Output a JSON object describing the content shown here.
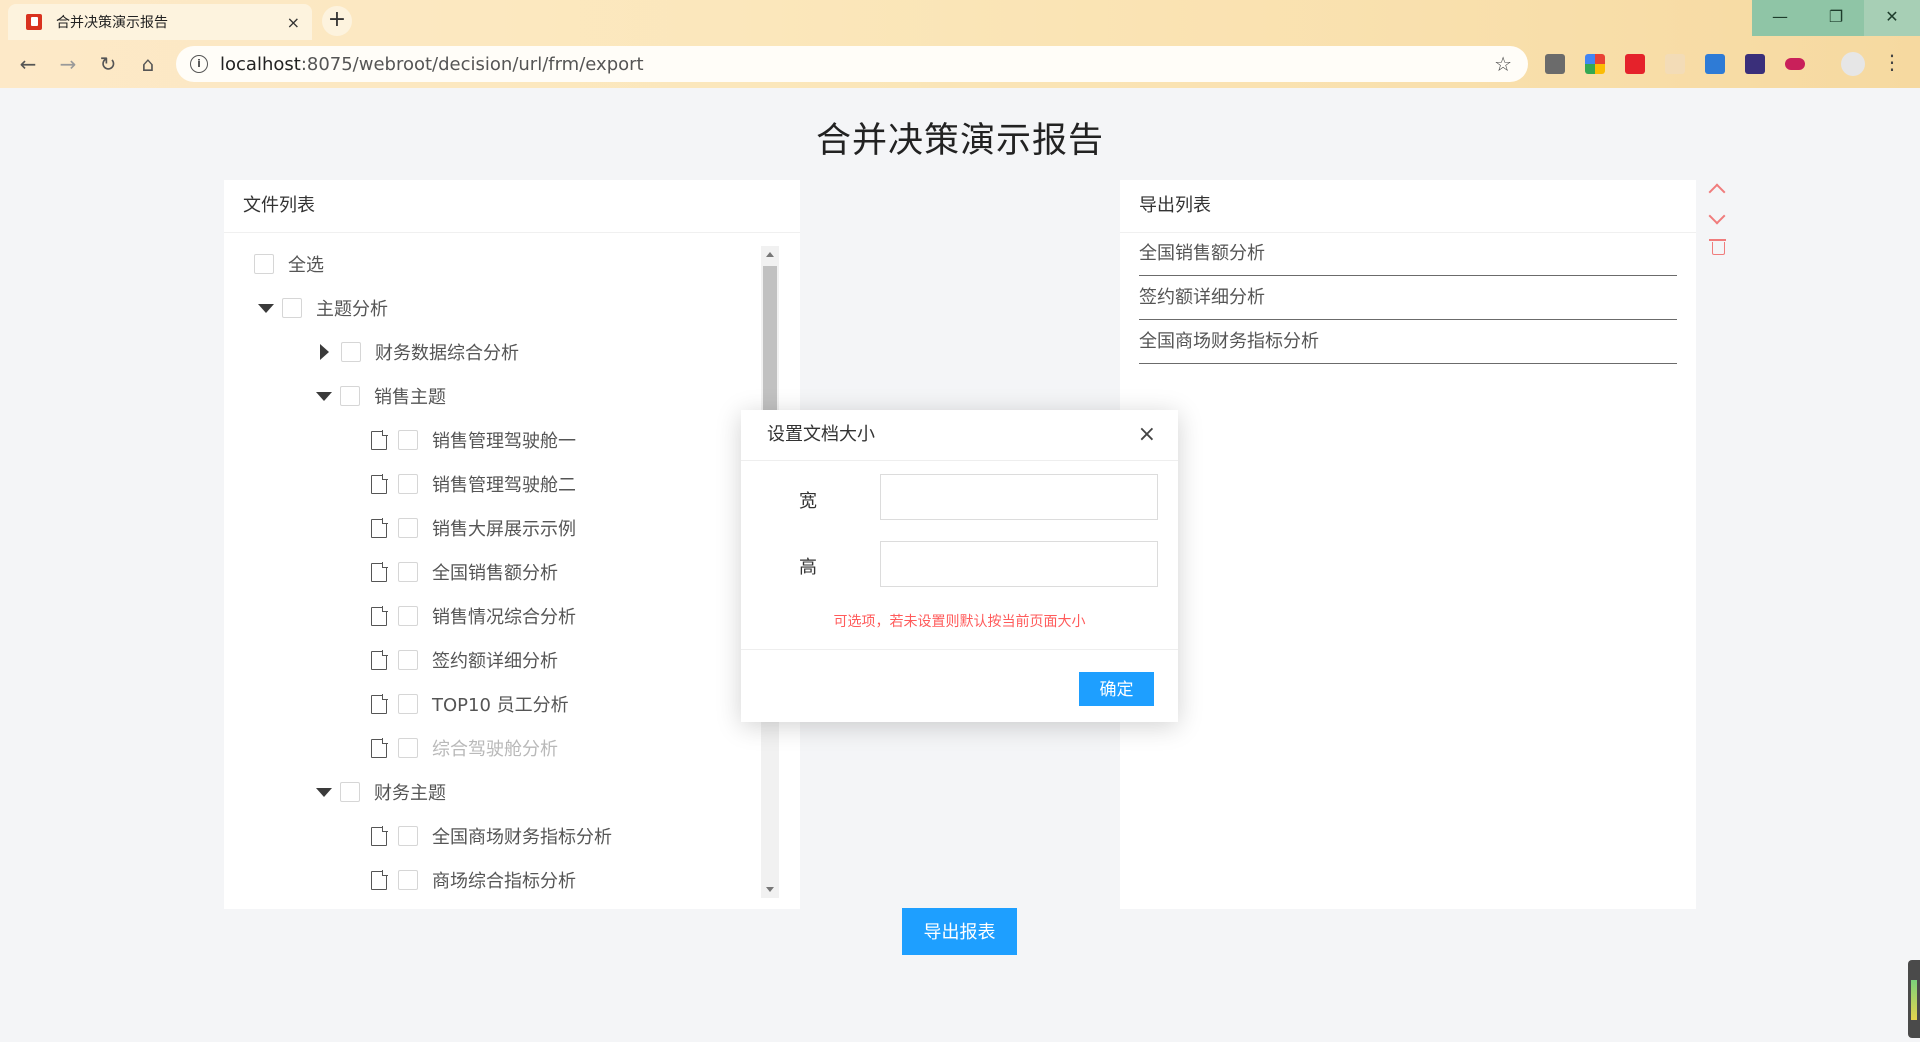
{
  "browser": {
    "tab_title": "合并决策演示报告",
    "tab_close": "×",
    "new_tab": "+",
    "url_host": "localhost",
    "url_rest": ":8075/webroot/decision/url/frm/export",
    "window_buttons": [
      "—",
      "❐",
      "✕"
    ]
  },
  "page": {
    "title": "合并决策演示报告"
  },
  "file_list": {
    "header": "文件列表",
    "select_all": "全选",
    "items": [
      {
        "label": "主题分析"
      },
      {
        "label": "财务数据综合分析"
      },
      {
        "label": "销售主题"
      },
      {
        "label": "销售管理驾驶舱一"
      },
      {
        "label": "销售管理驾驶舱二"
      },
      {
        "label": "销售大屏展示示例"
      },
      {
        "label": "全国销售额分析"
      },
      {
        "label": "销售情况综合分析"
      },
      {
        "label": "签约额详细分析"
      },
      {
        "label": "TOP10 员工分析"
      },
      {
        "label": "综合驾驶舱分析"
      },
      {
        "label": "财务主题"
      },
      {
        "label": "全国商场财务指标分析"
      },
      {
        "label": "商场综合指标分析"
      }
    ]
  },
  "export_list": {
    "header": "导出列表",
    "items": [
      {
        "label": "全国销售额分析"
      },
      {
        "label": "签约额详细分析"
      },
      {
        "label": "全国商场财务指标分析"
      }
    ]
  },
  "export_button": "导出报表",
  "modal": {
    "title": "设置文档大小",
    "close": "×",
    "width_label": "宽",
    "height_label": "高",
    "width_value": "",
    "height_value": "",
    "hint": "可选项，若未设置则默认按当前页面大小",
    "ok": "确定"
  },
  "colors": {
    "accent": "#1e9fff",
    "hint": "#ff5b5b",
    "tool": "#f07c7c"
  }
}
